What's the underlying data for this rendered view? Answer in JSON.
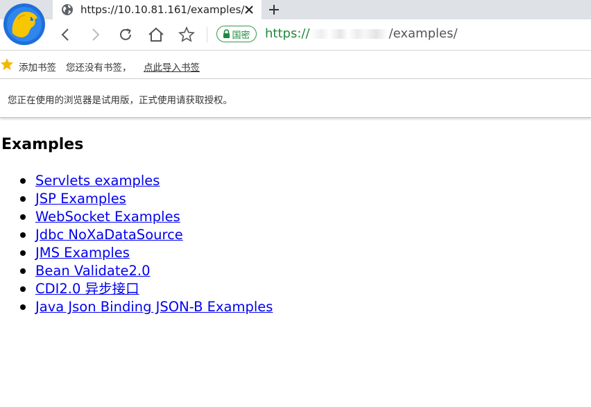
{
  "tab": {
    "title": "https://10.10.81.161/examples/",
    "close_icon": "close-icon",
    "new_tab_icon": "plus-icon"
  },
  "address": {
    "badge_label": "国密",
    "scheme": "https://",
    "path": "/examples/"
  },
  "bookmarks": {
    "add_label": "添加书签",
    "none_label": "您还没有书签，",
    "import_label": "点此导入书签"
  },
  "notice": {
    "text": "您正在使用的浏览器是试用版，正式使用请获取授权。"
  },
  "page": {
    "heading": "Examples",
    "links": [
      "Servlets examples",
      "JSP Examples",
      "WebSocket Examples",
      "Jdbc NoXaDataSource",
      "JMS Examples",
      "Bean Validate2.0",
      "CDI2.0 异步接口",
      "Java Json Binding JSON-B Examples"
    ]
  },
  "colors": {
    "link": "#0000ee",
    "secure_green": "#1e8a3c",
    "tabbar_bg": "#dee1e6",
    "star": "#f5b800"
  }
}
